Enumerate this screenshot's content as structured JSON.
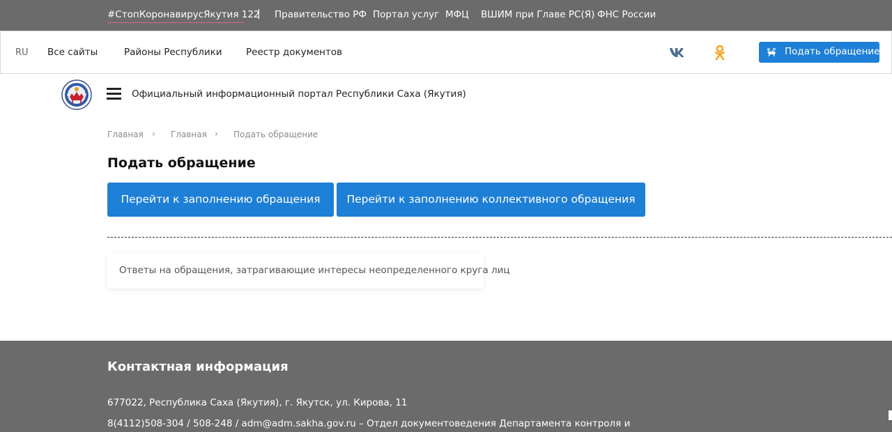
{
  "topbar": {
    "hashtag": "#СтопКоронавирусЯкутия 122",
    "separator": "|",
    "links": [
      "Правительство РФ",
      "Портал услуг",
      "МФЦ",
      "ВШИМ при Главе РС(Я)",
      "ФНС России"
    ]
  },
  "nav": {
    "lang": "RU",
    "links": [
      "Все сайты",
      "Районы Республики",
      "Реестр документов"
    ],
    "social_icons": [
      "vk-icon",
      "odnoklassniki-icon"
    ],
    "appeal_button": "Подать обращение",
    "accent_color": "#1e7fd6"
  },
  "header": {
    "portal_title": "Официальный информационный портал Республики Саха (Якутия)"
  },
  "breadcrumbs": [
    "Главная",
    "Главная",
    "Подать обращение"
  ],
  "main": {
    "title": "Подать обращение",
    "button_individual": "Перейти к заполнению обращения",
    "button_collective": "Перейти к заполнению коллективного обращения",
    "card_text": "Ответы на обращения, затрагивающие интересы неопределенного круга лиц"
  },
  "footer": {
    "heading": "Контактная информация",
    "address": "677022, Республика Саха (Якутия), г. Якутск, ул. Кирова, 11",
    "contacts": "8(4112)508-304 / 508-248 / adm@adm.sakha.gov.ru – Отдел документоведения Департамента контроля и"
  }
}
